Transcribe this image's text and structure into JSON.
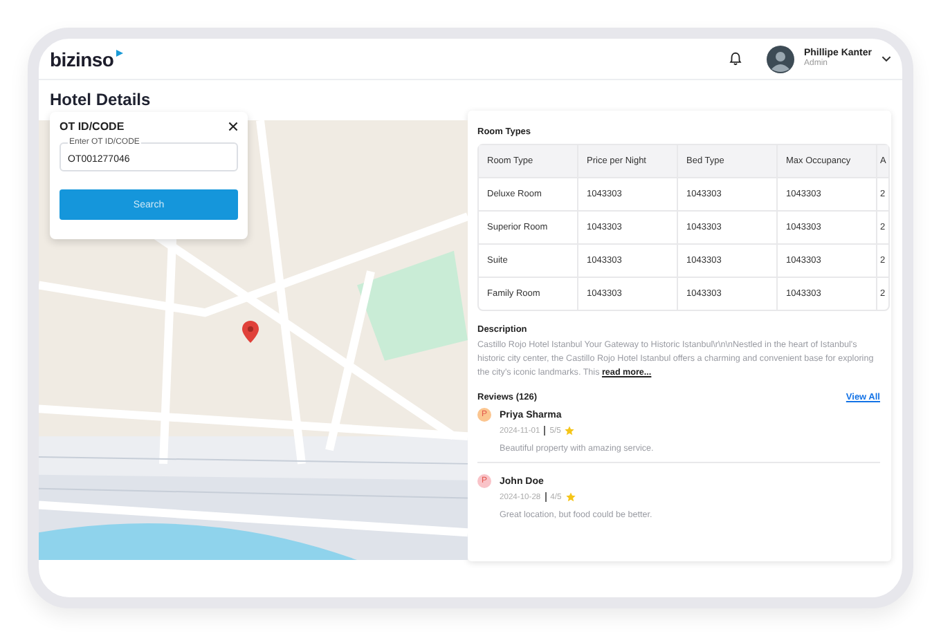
{
  "header": {
    "logo": "bizinso",
    "user": {
      "name": "Phillipe Kanter",
      "role": "Admin"
    }
  },
  "page": {
    "title": "Hotel Details"
  },
  "lookup": {
    "title": "OT ID/CODE",
    "field": {
      "label": "Enter OT ID/CODE",
      "value": "OT001277046"
    },
    "button": "Search"
  },
  "room_types": {
    "title": "Room Types",
    "columns": [
      "Room Type",
      "Price per Night",
      "Bed Type",
      "Max Occupancy",
      "A"
    ],
    "rows": [
      [
        "Deluxe Room",
        "1043303",
        "1043303",
        "1043303",
        "2"
      ],
      [
        "Superior Room",
        "1043303",
        "1043303",
        "1043303",
        "2"
      ],
      [
        "Suite",
        "1043303",
        "1043303",
        "1043303",
        "2"
      ],
      [
        "Family Room",
        "1043303",
        "1043303",
        "1043303",
        "2"
      ]
    ]
  },
  "description": {
    "title": "Description",
    "text": "Castillo Rojo Hotel Istanbul Your Gateway to Historic Istanbul\\r\\n\\nNestled in the heart of Istanbul's historic city center, the Castillo Rojo Hotel Istanbul offers a charming and convenient base for exploring the city's iconic landmarks. This",
    "link": "read more..."
  },
  "reviews": {
    "title": "Reviews (126)",
    "link": "View All",
    "items": [
      {
        "initial": "P",
        "color": "#fbc58f",
        "name": "Priya Sharma",
        "date": "2024-11-01",
        "rating": "5/5",
        "text": "Beautiful property with amazing service."
      },
      {
        "initial": "P",
        "color": "#f9c3c8",
        "name": "John Doe",
        "date": "2024-10-28",
        "rating": "4/5",
        "text": "Great location, but food could be better."
      }
    ]
  }
}
